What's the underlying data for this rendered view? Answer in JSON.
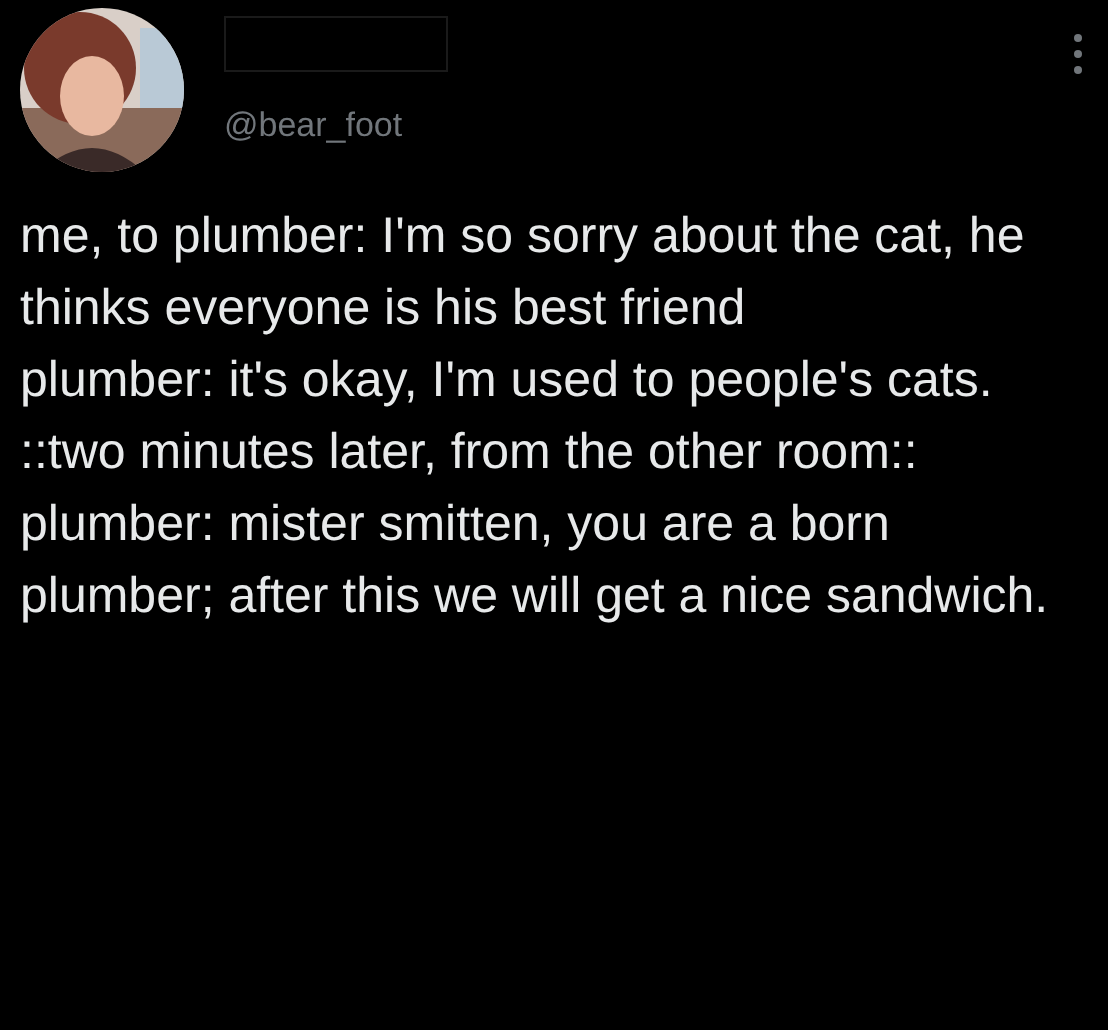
{
  "author": {
    "handle": "@bear_foot"
  },
  "tweet": {
    "paragraphs": [
      "me, to plumber: I'm so sorry about the cat, he thinks everyone is his best friend",
      "plumber: it's okay, I'm used to people's cats.",
      "::two minutes later, from the other room::",
      "plumber: mister smitten, you are a born plumber; after this we will get a nice sandwich."
    ]
  }
}
